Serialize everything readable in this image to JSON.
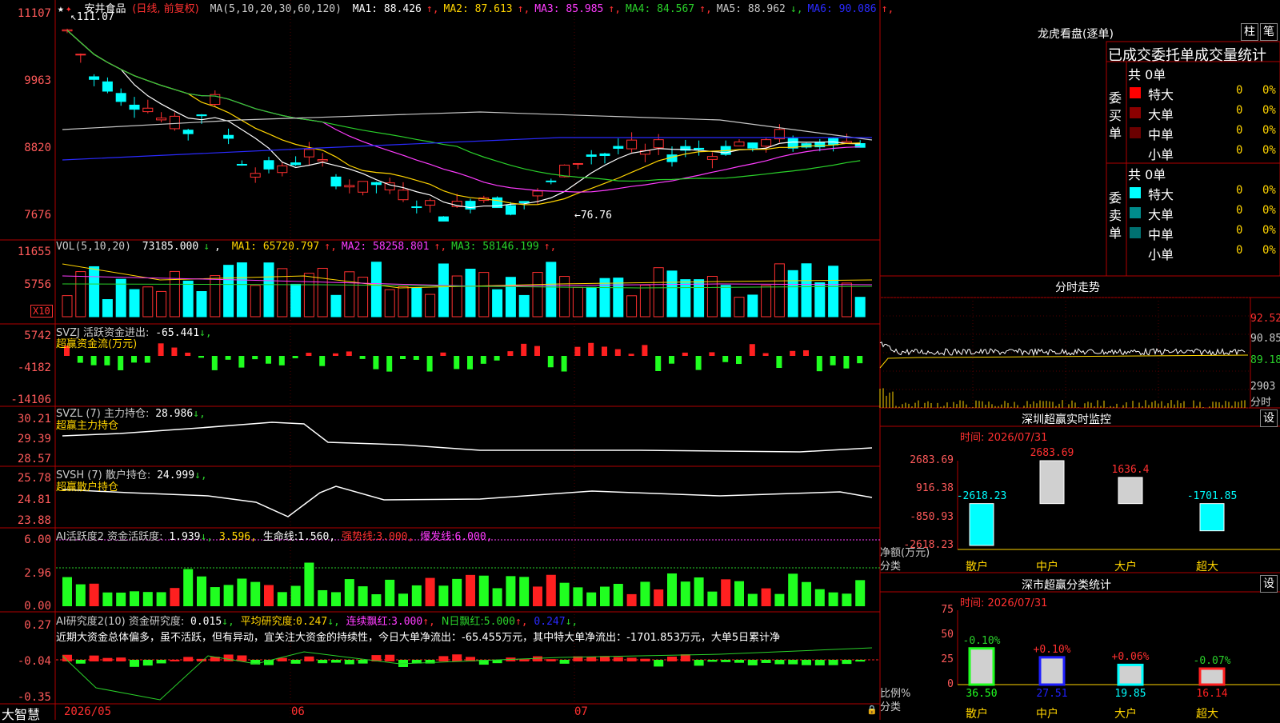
{
  "main": {
    "stock_name": "安井食品",
    "period": "(日线, 前复权)",
    "ma_label": "MA(5,10,20,30,60,120)",
    "ma": [
      {
        "label": "MA1:",
        "value": "88.426",
        "arrow": "↑",
        "color": "#ffffff"
      },
      {
        "label": "MA2:",
        "value": "87.613",
        "arrow": "↑",
        "color": "#ffd400"
      },
      {
        "label": "MA3:",
        "value": "85.985",
        "arrow": "↑",
        "color": "#ff3cff"
      },
      {
        "label": "MA4:",
        "value": "84.567",
        "arrow": "↑",
        "color": "#2ad12a"
      },
      {
        "label": "MA5:",
        "value": "88.962",
        "arrow": "↓",
        "color": "#c8c8c8"
      },
      {
        "label": "MA6:",
        "value": "90.086",
        "arrow": "↑",
        "color": "#2a2aff"
      }
    ],
    "y_labels": [
      "11107",
      "9963",
      "8820",
      "7676"
    ],
    "high_label": "111.07",
    "low_label": "76.76"
  },
  "vol": {
    "title": "VOL(5,10,20)",
    "value": "73185.000",
    "arrow": "↓",
    "ma": [
      {
        "label": "MA1:",
        "value": "65720.797",
        "arrow": "↑",
        "color": "#ffd400"
      },
      {
        "label": "MA2:",
        "value": "58258.801",
        "arrow": "↑",
        "color": "#ff3cff"
      },
      {
        "label": "MA3:",
        "value": "58146.199",
        "arrow": "↑",
        "color": "#2ad12a"
      }
    ],
    "y_labels": [
      "11655",
      "5756"
    ],
    "unit": "X10"
  },
  "svzj": {
    "title": "SVZJ  活跃资金进出:",
    "value": "-65.441",
    "arrow": "↓,",
    "subtitle": "超赢资金流(万元)",
    "y_labels": [
      "5742",
      "-4182",
      "-14106"
    ]
  },
  "svzl": {
    "title": "SVZL (7) 主力持仓:",
    "value": "28.986",
    "arrow": "↓,",
    "subtitle": "超赢主力持仓",
    "y_labels": [
      "30.21",
      "29.39",
      "28.57"
    ]
  },
  "svsh": {
    "title": "SVSH (7) 散户持仓:",
    "value": "24.999",
    "arrow": "↓,",
    "subtitle": "超赢散户持仓",
    "y_labels": [
      "25.78",
      "24.81",
      "23.88"
    ]
  },
  "ai_active": {
    "title": "AI活跃度2 资金活跃度:",
    "v1": "1.939",
    "a1": "↓,",
    "v2": "3.596,",
    "life_label": "生命线:",
    "life_value": "1.560,",
    "strong_label": "强势线:",
    "strong_value": "3.000,",
    "burst_label": "爆发线:",
    "burst_value": "6.000,",
    "y_labels": [
      "6.00",
      "2.96",
      "0.00"
    ]
  },
  "ai_research": {
    "title": "AI研究度2(10) 资金研究度:",
    "v1": "0.015",
    "a1": "↓,",
    "avg_label": "平均研究度:",
    "avg_value": "0.247",
    "a2": "↓,",
    "streak_label": "连续飘红:",
    "streak_value": "3.000",
    "a3": "↑,",
    "nday_label": "N日飘红:",
    "nday_value": "5.000",
    "a4": "↑,",
    "last_value": "0.247",
    "a5": "↓,",
    "comment": "近期大资金总体偏多，虽不活跃，但有异动，宜关注大资金的持续性，今日大单净流出：-65.455万元，其中特大单净流出：-1701.853万元，大单5日累计净",
    "y_labels": [
      "0.27",
      "-0.04",
      "-0.35"
    ]
  },
  "footer": {
    "brand": "大智慧",
    "dates": [
      "2026/05",
      "06",
      "07"
    ]
  },
  "right": {
    "lhb_title": "龙虎看盘(逐单)",
    "btn_zhu": "柱",
    "btn_bi": "笔",
    "tabs_title": "已成交委托单成交量统计",
    "buy": {
      "total": "共 0单",
      "label": "委买单",
      "rows": [
        {
          "name": "特大",
          "count": "0",
          "pct": "0%",
          "color": "#ff0000"
        },
        {
          "name": "大单",
          "count": "0",
          "pct": "0%",
          "color": "#8b0000"
        },
        {
          "name": "中单",
          "count": "0",
          "pct": "0%",
          "color": "#6b0000"
        },
        {
          "name": "小单",
          "count": "0",
          "pct": "0%",
          "color": "#000000"
        }
      ]
    },
    "sell": {
      "total": "共 0单",
      "label": "委卖单",
      "rows": [
        {
          "name": "特大",
          "count": "0",
          "pct": "0%",
          "color": "#00ffff"
        },
        {
          "name": "大单",
          "count": "0",
          "pct": "0%",
          "color": "#008b8b"
        },
        {
          "name": "中单",
          "count": "0",
          "pct": "0%",
          "color": "#007070"
        },
        {
          "name": "小单",
          "count": "0",
          "pct": "0%",
          "color": "#000000"
        }
      ]
    },
    "intraday": {
      "title": "分时走势",
      "y_labels": [
        "92.52",
        "90.85",
        "89.18"
      ],
      "vol_label": "2903",
      "unit": "分时"
    },
    "sz_monitor": {
      "title": "深圳超赢实时监控",
      "set": "设",
      "time": "时间: 2026/07/31",
      "y_labels": [
        "2683.69",
        "916.38",
        "-850.93",
        "-2618.23"
      ],
      "ylabel": "净额(万元)",
      "xlabel": "分类",
      "categories": [
        "散户",
        "中户",
        "大户",
        "超大"
      ],
      "values": [
        -2618.23,
        2683.69,
        1636.4,
        -1701.85
      ],
      "value_labels": [
        "-2618.23",
        "2683.69",
        "1636.4",
        "-1701.85"
      ]
    },
    "sz_stats": {
      "title": "深市超赢分类统计",
      "set": "设",
      "time": "时间: 2026/07/31",
      "y_labels": [
        "75",
        "50",
        "25",
        "0"
      ],
      "ylabel": "比例%",
      "xlabel": "分类",
      "categories": [
        "散户",
        "中户",
        "大户",
        "超大"
      ],
      "values": [
        36.5,
        27.51,
        19.85,
        16.14
      ],
      "value_labels": [
        "36.50",
        "27.51",
        "19.85",
        "16.14"
      ],
      "changes": [
        "-0.10%",
        "+0.10%",
        "+0.06%",
        "-0.07%"
      ]
    }
  },
  "chart_data": [
    {
      "type": "bar",
      "title": "深圳超赢实时监控",
      "ylabel": "净额(万元)",
      "categories": [
        "散户",
        "中户",
        "大户",
        "超大"
      ],
      "values": [
        -2618.23,
        2683.69,
        1636.4,
        -1701.85
      ],
      "ylim": [
        -2618.23,
        2683.69
      ]
    },
    {
      "type": "bar",
      "title": "深市超赢分类统计",
      "ylabel": "比例%",
      "categories": [
        "散户",
        "中户",
        "大户",
        "超大"
      ],
      "values": [
        36.5,
        27.51,
        19.85,
        16.14
      ],
      "ylim": [
        0,
        75
      ]
    }
  ]
}
